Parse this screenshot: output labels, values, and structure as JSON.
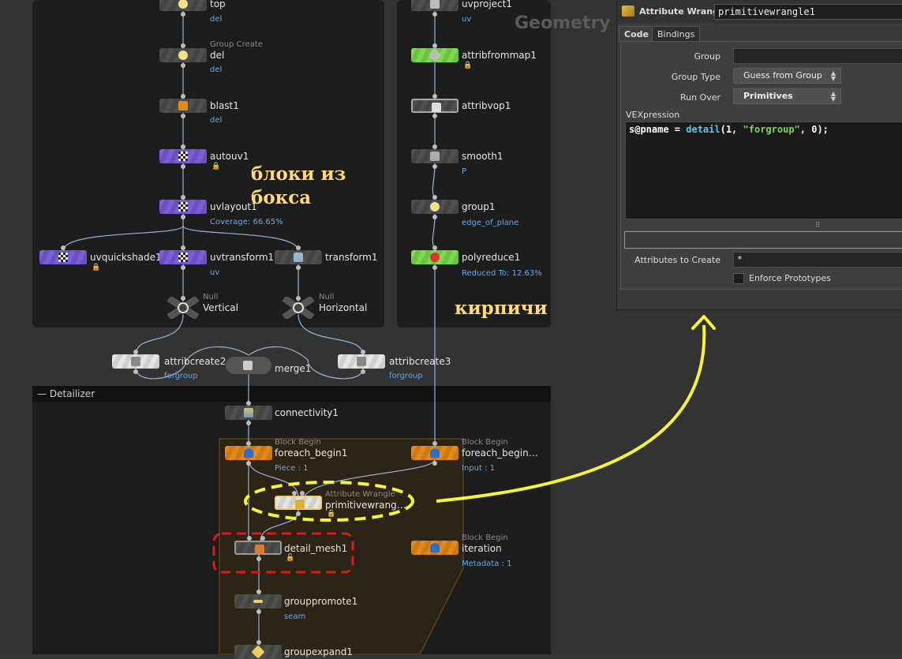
{
  "network": {
    "watermark": "Geometry",
    "annotations": {
      "box_note": "блоки из\nбокса",
      "bricks_note": "кирпичи"
    },
    "detailizer_title": "Detailizer",
    "nodes": {
      "top": {
        "name": "top",
        "sub": "del"
      },
      "del": {
        "type": "Group Create",
        "name": "del",
        "sub": "del"
      },
      "blast1": {
        "name": "blast1",
        "sub": "del"
      },
      "autouv1": {
        "name": "autouv1"
      },
      "uvlayout1": {
        "name": "uvlayout1",
        "sub": "Coverage: 66.65%"
      },
      "uvquickshade1": {
        "name": "uvquickshade1"
      },
      "uvtransform1": {
        "name": "uvtransform1",
        "sub": "uv"
      },
      "transform1": {
        "name": "transform1"
      },
      "vertical": {
        "type": "Null",
        "name": "Vertical"
      },
      "horizontal": {
        "type": "Null",
        "name": "Horizontal"
      },
      "uvproject1": {
        "name": "uvproject1",
        "sub": "uv"
      },
      "attribfrommap1": {
        "name": "attribfrommap1"
      },
      "attribvop1": {
        "name": "attribvop1"
      },
      "smooth1": {
        "name": "smooth1",
        "sub": "P"
      },
      "group1": {
        "name": "group1",
        "sub": "edge_of_plane"
      },
      "polyreduce1": {
        "name": "polyreduce1",
        "sub": "Reduced To: 12.63%"
      },
      "attribcreate2": {
        "name": "attribcreate2",
        "sub": "forgroup"
      },
      "merge1": {
        "name": "merge1"
      },
      "attribcreate3": {
        "name": "attribcreate3",
        "sub": "forgroup"
      },
      "connectivity1": {
        "name": "connectivity1"
      },
      "foreach_begin1": {
        "type": "Block Begin",
        "name": "foreach_begin1",
        "sub": "Piece : 1"
      },
      "foreach_begin2": {
        "type": "Block Begin",
        "name": "foreach_begin…",
        "sub": "Input : 1"
      },
      "primitivewrangle1": {
        "type": "Attribute Wrangle",
        "name": "primitivewrang…"
      },
      "detail_mesh1": {
        "name": "detail_mesh1"
      },
      "iteration": {
        "type": "Block Begin",
        "name": "iteration",
        "sub": "Metadata : 1"
      },
      "grouppromote1": {
        "name": "grouppromote1",
        "sub": "seam"
      },
      "groupexpand1": {
        "name": "groupexpand1"
      }
    }
  },
  "panel": {
    "node_type": "Attribute Wrangle",
    "node_name": "primitivewrangle1",
    "tabs": [
      "Code",
      "Bindings"
    ],
    "params": {
      "group_label": "Group",
      "group_value": "",
      "group_type_label": "Group Type",
      "group_type_value": "Guess from Group",
      "run_over_label": "Run Over",
      "run_over_value": "Primitives",
      "vex_label": "VEXpression",
      "vex_code": {
        "a": "s@pname = ",
        "b": "detail",
        "c": "(1, ",
        "d": "\"forgroup\"",
        "e": ", 0);"
      },
      "attrs_label": "Attributes to Create",
      "attrs_value": "*",
      "enforce_label": "Enforce Prototypes"
    }
  },
  "colors": {
    "highlight_yellow": "#f5f532",
    "highlight_red": "#e01818",
    "orange_node": "#e08a1c"
  }
}
